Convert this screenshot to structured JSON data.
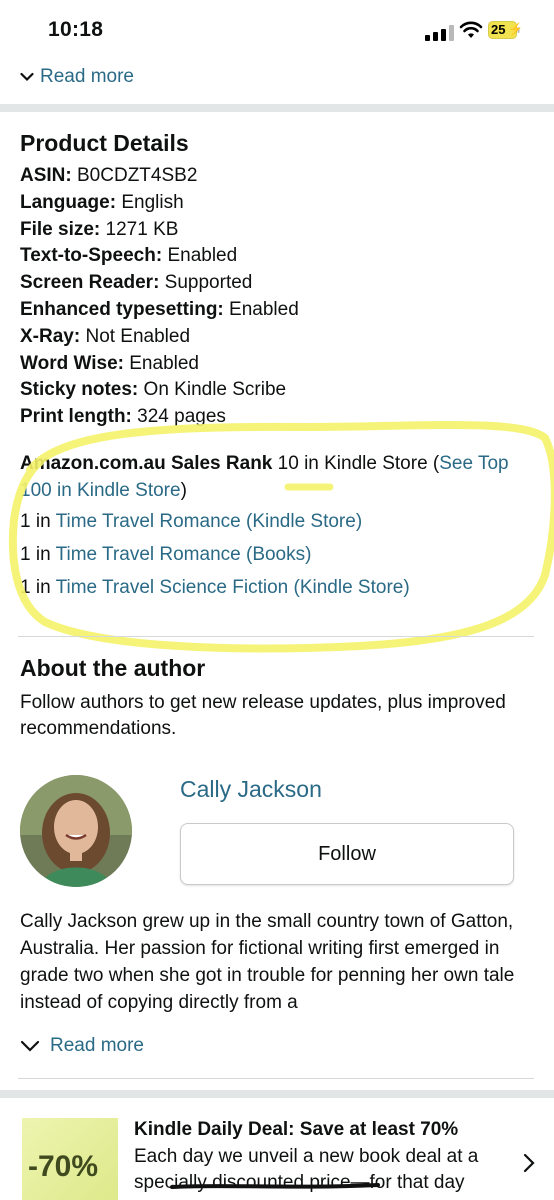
{
  "status_bar": {
    "time": "10:18",
    "battery": "25"
  },
  "top": {
    "read_more": "Read more"
  },
  "product_details": {
    "title": "Product Details",
    "rows": [
      {
        "label": "ASIN:",
        "value": " B0CDZT4SB2"
      },
      {
        "label": "Language:",
        "value": " English"
      },
      {
        "label": "File size:",
        "value": " 1271 KB"
      },
      {
        "label": "Text-to-Speech:",
        "value": " Enabled"
      },
      {
        "label": "Screen Reader:",
        "value": " Supported"
      },
      {
        "label": "Enhanced typesetting:",
        "value": " Enabled"
      },
      {
        "label": "X-Ray:",
        "value": " Not Enabled"
      },
      {
        "label": "Word Wise:",
        "value": " Enabled"
      },
      {
        "label": "Sticky notes:",
        "value": " On Kindle Scribe"
      },
      {
        "label": "Print length:",
        "value": " 324 pages"
      }
    ]
  },
  "sales_rank": {
    "label": "Amazon.com.au Sales Rank",
    "value": " 10 in Kindle Store (",
    "top_link": "See Top 100 in Kindle Store",
    "close": ")",
    "categories": [
      {
        "prefix": "1 in ",
        "link": "Time Travel Romance (Kindle Store)"
      },
      {
        "prefix": "1 in ",
        "link": "Time Travel Romance (Books)"
      },
      {
        "prefix": "1 in ",
        "link": "Time Travel Science Fiction (Kindle Store)"
      }
    ]
  },
  "about": {
    "title": "About the author",
    "description": "Follow authors to get new release updates, plus improved recommendations.",
    "author_name": "Cally Jackson",
    "follow_label": "Follow",
    "bio": "Cally Jackson grew up in the small country town of Gatton, Australia. Her passion for fictional writing first emerged in grade two when she got in trouble for penning her own tale instead of copying directly from a",
    "read_more": "Read more"
  },
  "deal": {
    "badge": "-70%",
    "title": "Kindle Daily Deal: Save at least 70%",
    "description": "Each day we unveil a new book deal at a specially discounted price—for that day"
  },
  "colors": {
    "link": "#2a6a86",
    "highlight": "#f4f36a",
    "divider": "#d5d9d9"
  }
}
